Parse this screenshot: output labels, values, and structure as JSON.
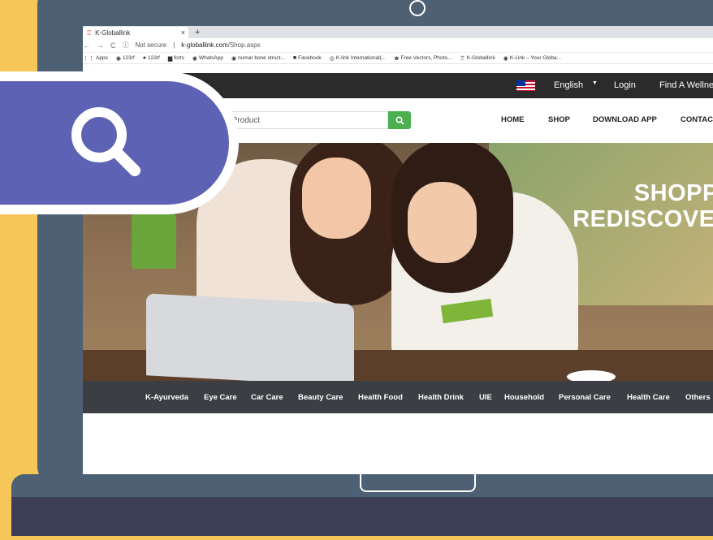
{
  "browser": {
    "tab_title": "K-Globallink",
    "tab_close": "×",
    "new_tab": "+",
    "nav_back": "←",
    "nav_forward": "→",
    "nav_reload": "C",
    "security": "Not secure",
    "url_host": "k-globallink.com",
    "url_path": "/Shop.aspx",
    "bookmarks": [
      {
        "icon": "⋮⋮",
        "label": "Apps"
      },
      {
        "icon": "◉",
        "label": "123rf"
      },
      {
        "icon": "●",
        "label": "123rf"
      },
      {
        "icon": "▆",
        "label": "forts"
      },
      {
        "icon": "◉",
        "label": "WhatsApp"
      },
      {
        "icon": "◉",
        "label": "numar bone struct..."
      },
      {
        "icon": "■",
        "label": "Facebook"
      },
      {
        "icon": "◎",
        "label": "K-link International(..."
      },
      {
        "icon": "♚",
        "label": "Free Vectors, Photo..."
      },
      {
        "icon": "♖",
        "label": "K-Globallink"
      },
      {
        "icon": "◉",
        "label": "K-Link – Your Globa..."
      }
    ]
  },
  "topbar": {
    "language": "English",
    "caret": "▼",
    "login": "Login",
    "find": "Find A Wellnes"
  },
  "header": {
    "search_placeholder": "rch Product",
    "nav": [
      "HOME",
      "SHOP",
      "DOWNLOAD APP",
      "CONTAC"
    ]
  },
  "hero": {
    "line1": "SHOPPII",
    "line2": "REDISCOVER"
  },
  "categories": [
    "K-Ayurveda",
    "Eye Care",
    "Car Care",
    "Beauty Care",
    "Health Food",
    "Health Drink",
    "UIE",
    "Household",
    "Personal Care",
    "Health Care",
    "Others"
  ],
  "colors": {
    "accent_green": "#4caf50",
    "badge_purple": "#5d62b5",
    "laptop_frame": "#4e6074",
    "background": "#f6c659"
  }
}
